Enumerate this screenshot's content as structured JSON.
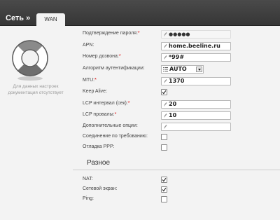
{
  "header": {
    "breadcrumb": "Сеть »",
    "tab": "WAN"
  },
  "help_note": "Для данных настроек документация отсутствует",
  "fields": {
    "password_confirm": {
      "label": "Подтверждение пароля:",
      "value": "●●●●●"
    },
    "apn": {
      "label": "APN:",
      "value": "home.beeline.ru"
    },
    "dial_number": {
      "label": "Номер дозвона:",
      "value": "*99#"
    },
    "auth_algorithm": {
      "label": "Алгоритм аутентификации:",
      "value": "AUTO"
    },
    "mtu": {
      "label": "MTU:",
      "value": "1370"
    },
    "keep_alive": {
      "label": "Keep Alive:",
      "checked": true
    },
    "lcp_interval": {
      "label": "LCP интервал (сек):",
      "value": "20"
    },
    "lcp_failures": {
      "label": "LCP провалы:",
      "value": "10"
    },
    "extra_options": {
      "label": "Дополнительные опции:",
      "value": ""
    },
    "on_demand": {
      "label": "Соединение по требованию:",
      "checked": false
    },
    "ppp_debug": {
      "label": "Отладка PPP:",
      "checked": false
    }
  },
  "misc": {
    "title": "Разное",
    "nat": {
      "label": "NAT:",
      "checked": true
    },
    "firewall": {
      "label": "Сетевой экран:",
      "checked": true
    },
    "ping": {
      "label": "Ping:",
      "checked": false
    }
  },
  "required_mark": "*",
  "icons": [
    "lifebuoy-icon",
    "pencil-icon",
    "list-icon",
    "chevron-down-icon",
    "checkmark-icon"
  ]
}
